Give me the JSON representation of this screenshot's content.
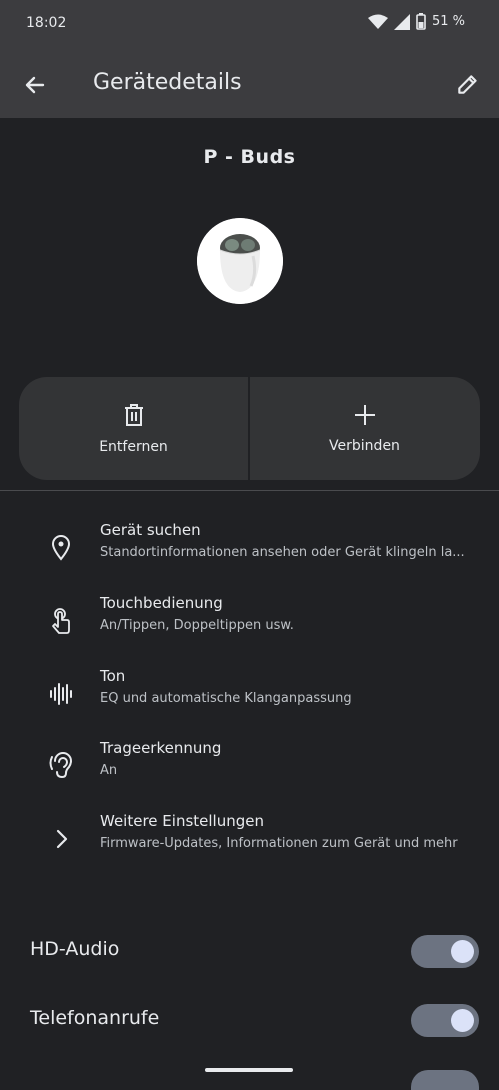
{
  "status_bar": {
    "time": "18:02",
    "battery_percent": "51 %",
    "icons": [
      "wifi-icon",
      "signal-icon",
      "battery-icon"
    ]
  },
  "app_bar": {
    "title": "Gerätedetails",
    "back_icon": "arrow-back-icon",
    "edit_icon": "pencil-icon"
  },
  "device": {
    "name": "P - Buds"
  },
  "actions": {
    "remove_label": "Entfernen",
    "connect_label": "Verbinden"
  },
  "settings_list": [
    {
      "icon": "location-pin-icon",
      "title": "Gerät suchen",
      "subtitle": "Standortinformationen ansehen oder Gerät klingeln la..."
    },
    {
      "icon": "touch-gesture-icon",
      "title": "Touchbedienung",
      "subtitle": "An/Tippen, Doppeltippen usw."
    },
    {
      "icon": "sound-wave-icon",
      "title": "Ton",
      "subtitle": "EQ und automatische Klanganpassung"
    },
    {
      "icon": "ear-detection-icon",
      "title": "Trageerkennung",
      "subtitle": "An"
    },
    {
      "icon": "chevron-right-icon",
      "title": "Weitere Einstellungen",
      "subtitle": "Firmware-Updates, Informationen zum Gerät und mehr"
    }
  ],
  "toggles": [
    {
      "label": "HD-Audio",
      "on": true
    },
    {
      "label": "Telefonanrufe",
      "on": true
    }
  ],
  "colors": {
    "background": "#202124",
    "app_bar": "#3c3c3f",
    "card": "#333436",
    "switch_track": "#6c7381",
    "switch_knob": "#dbe2f8"
  }
}
